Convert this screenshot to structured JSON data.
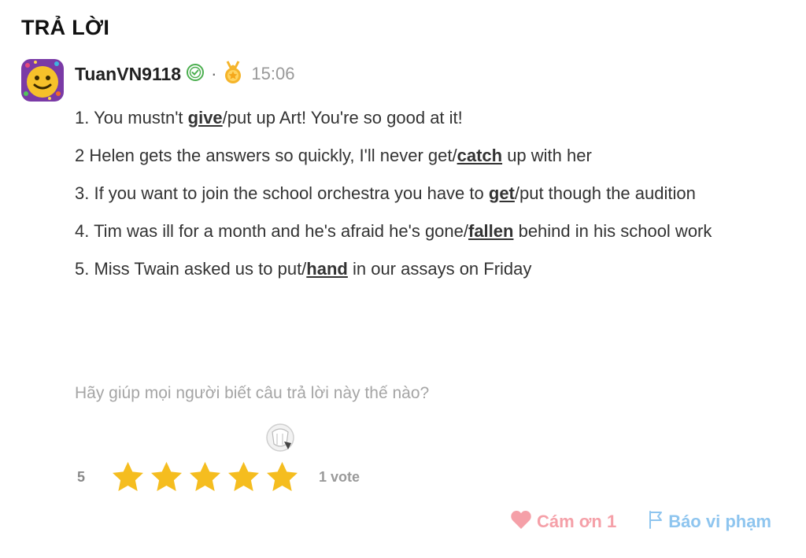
{
  "section": {
    "title": "TRẢ LỜI"
  },
  "answer_meta": {
    "username": "TuanVN9118",
    "separator": "·",
    "time": "15:06"
  },
  "answer": {
    "lines": [
      {
        "before": "1. You mustn't ",
        "highlight": "give",
        "after": "/put up Art! You're so good at it!"
      },
      {
        "before": "2 Helen gets the answers so quickly, I'll never get/",
        "highlight": "catch",
        "after": " up with her"
      },
      {
        "before": "3. If you want to join the school orchestra you have to ",
        "highlight": "get",
        "after": "/put though the audition"
      },
      {
        "before": "4. Tim was ill for a month and he's afraid he's gone/",
        "highlight": "fallen",
        "after": " behind in his school work"
      },
      {
        "before": "5. Miss Twain asked us to put/",
        "highlight": "hand",
        "after": " in our assays on Friday"
      }
    ]
  },
  "rating": {
    "prompt": "Hãy giúp mọi người biết câu trả lời này thế nào?",
    "value": "5",
    "stars_filled": 5,
    "stars_total": 5,
    "votes": "1 vote",
    "star_color": "#f5bd1f"
  },
  "actions": {
    "thank_label": "Cám ơn 1",
    "report_label": "Báo vi phạm",
    "thank_color": "#f5a0a8",
    "report_color": "#8ec5ef"
  }
}
